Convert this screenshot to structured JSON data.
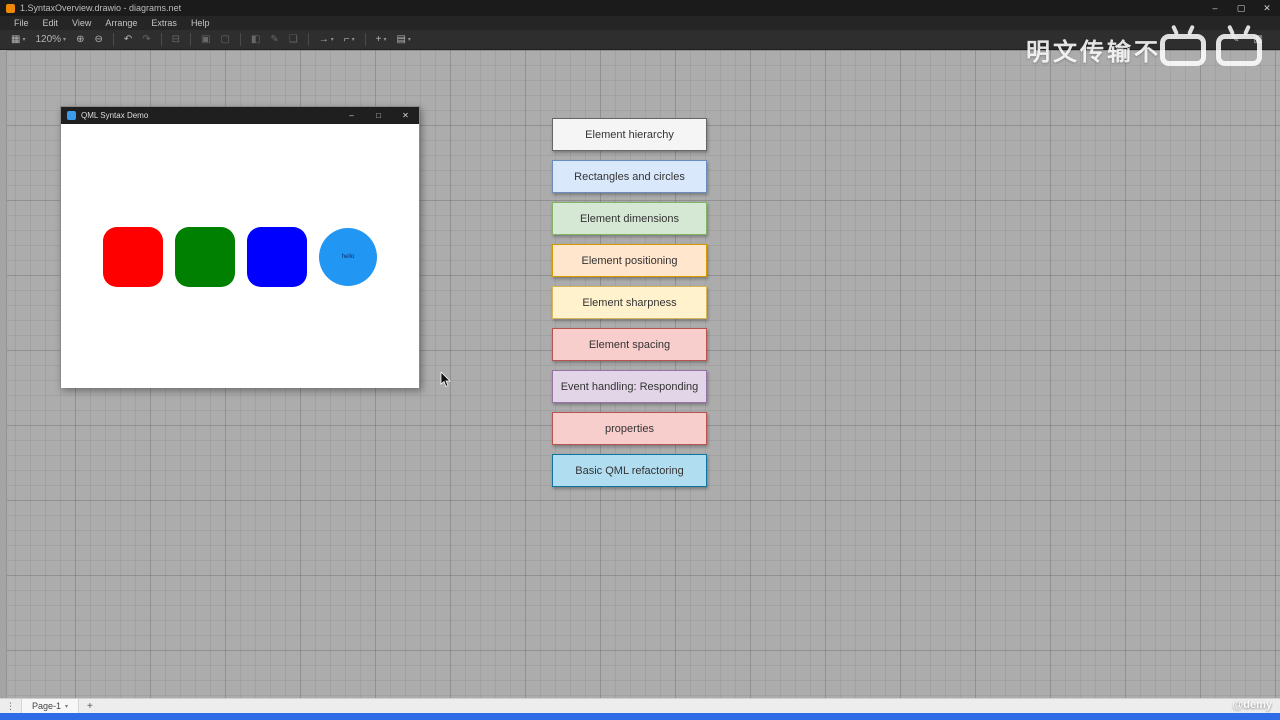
{
  "app_window": {
    "title": "1.SyntaxOverview.drawio - diagrams.net",
    "minimize": "–",
    "maximize": "▢",
    "close": "✕"
  },
  "menu": {
    "items": [
      "File",
      "Edit",
      "View",
      "Arrange",
      "Extras",
      "Help"
    ]
  },
  "toolbar": {
    "zoom_level": "120%",
    "left_icons": [
      {
        "name": "view-toggle-icon",
        "glyph": "▦",
        "caret": true
      },
      {
        "name": "zoom-level",
        "zoom": true,
        "caret": true
      },
      {
        "name": "zoom-in-icon",
        "glyph": "⊕"
      },
      {
        "name": "zoom-out-icon",
        "glyph": "⊖"
      },
      {
        "sep": true
      },
      {
        "name": "undo-icon",
        "glyph": "↶"
      },
      {
        "name": "redo-icon",
        "glyph": "↷",
        "dim": true
      },
      {
        "sep": true
      },
      {
        "name": "delete-icon",
        "glyph": "⊟",
        "dim": true
      },
      {
        "sep": true
      },
      {
        "name": "to-front-icon",
        "glyph": "▣",
        "dim": true
      },
      {
        "name": "to-back-icon",
        "glyph": "▢",
        "dim": true
      },
      {
        "sep": true
      },
      {
        "name": "fill-color-icon",
        "glyph": "◧",
        "dim": true
      },
      {
        "name": "line-color-icon",
        "glyph": "✎",
        "dim": true
      },
      {
        "name": "shadow-icon",
        "glyph": "❏",
        "dim": true
      },
      {
        "sep": true
      },
      {
        "name": "connection-icon",
        "glyph": "→",
        "caret": true
      },
      {
        "name": "waypoints-icon",
        "glyph": "⌐",
        "caret": true
      },
      {
        "sep": true
      },
      {
        "name": "insert-icon",
        "glyph": "+",
        "caret": true
      },
      {
        "name": "table-icon",
        "glyph": "▤",
        "caret": true
      }
    ],
    "right_icons": [
      {
        "name": "sketch-icon",
        "glyph": "✎"
      },
      {
        "name": "format-panel-icon",
        "glyph": "▥"
      }
    ]
  },
  "qml_window": {
    "title": "QML Syntax Demo",
    "controls": {
      "minimize": "–",
      "maximize": "□",
      "close": "✕"
    },
    "shapes": [
      {
        "type": "rounded-rect",
        "color": "#ff0000",
        "name": "red-rounded-rectangle"
      },
      {
        "type": "rounded-rect",
        "color": "#008000",
        "name": "green-rounded-rectangle"
      },
      {
        "type": "rounded-rect",
        "color": "#0000ff",
        "name": "blue-rounded-rectangle"
      },
      {
        "type": "circle",
        "color": "#2196f3",
        "label": "hello",
        "name": "blue-circle"
      }
    ]
  },
  "flow_boxes": [
    {
      "label": "Element hierarchy",
      "fill": "#f5f5f5",
      "stroke": "#666666"
    },
    {
      "label": "Rectangles and circles",
      "fill": "#dae8fc",
      "stroke": "#6c8ebf"
    },
    {
      "label": "Element dimensions",
      "fill": "#d5e8d4",
      "stroke": "#82b366"
    },
    {
      "label": "Element positioning",
      "fill": "#ffe6cc",
      "stroke": "#d79b00"
    },
    {
      "label": "Element sharpness",
      "fill": "#fff2cc",
      "stroke": "#d6b656"
    },
    {
      "label": "Element spacing",
      "fill": "#f8cecc",
      "stroke": "#b85450"
    },
    {
      "label": "Event handling: Responding",
      "fill": "#e1d5e7",
      "stroke": "#9673a6"
    },
    {
      "label": "properties",
      "fill": "#f8cecc",
      "stroke": "#b85450"
    },
    {
      "label": "Basic QML refactoring",
      "fill": "#b1ddf0",
      "stroke": "#10739e"
    }
  ],
  "footer": {
    "page_tab": "Page-1",
    "add_label": "+",
    "dots": "⋮"
  },
  "watermarks": {
    "top_text": "明文传输不",
    "credit": "@demy"
  },
  "colors": {
    "accent_bar": "#2e6be6",
    "canvas_bg": "#acacac"
  }
}
